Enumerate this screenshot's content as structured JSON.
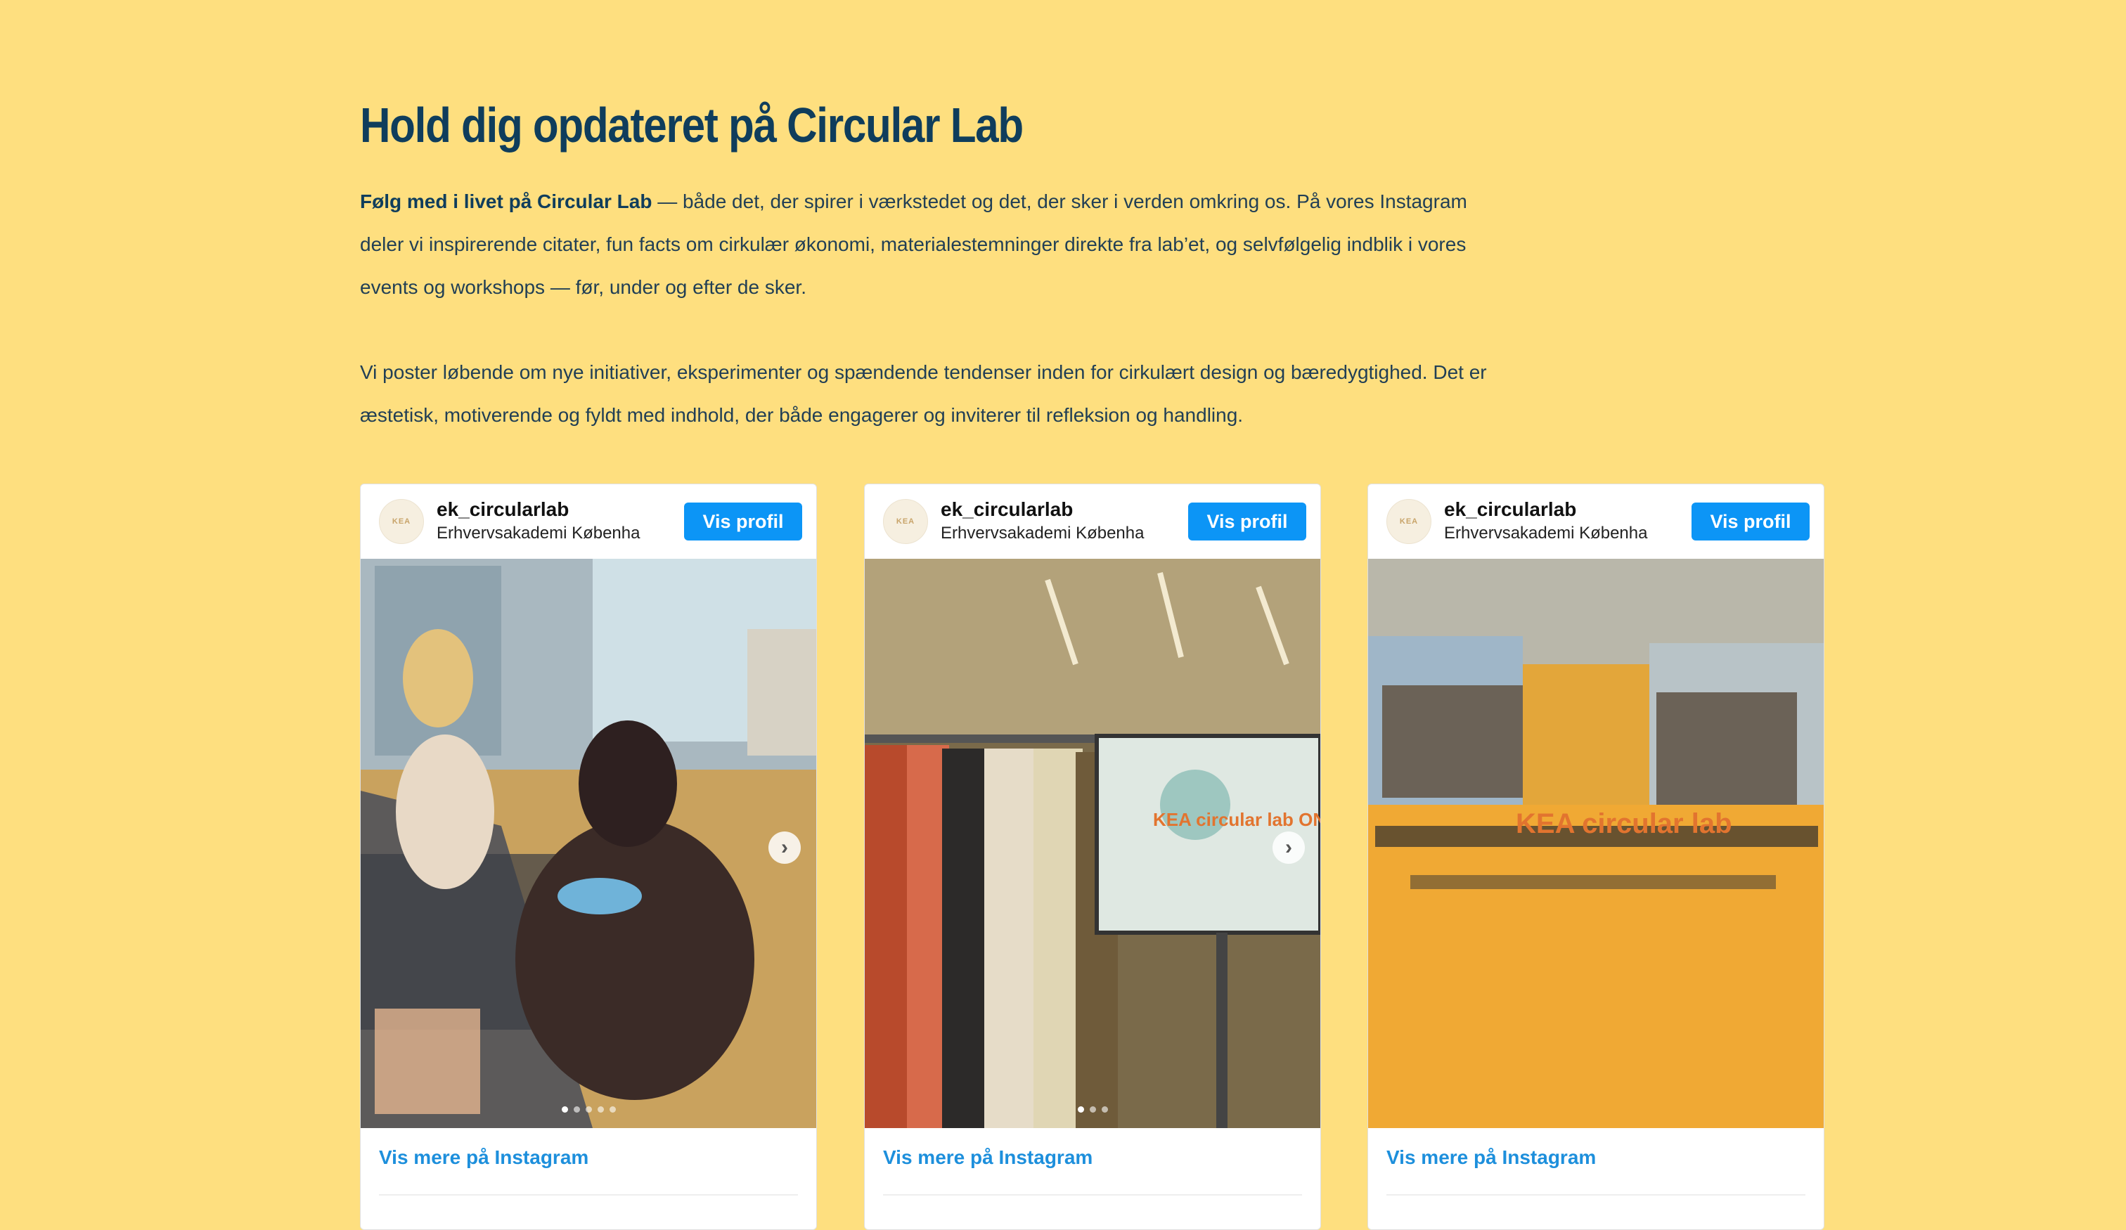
{
  "header": {
    "title": "Hold dig opdateret på Circular Lab"
  },
  "intro": {
    "lead": "Følg med i livet på Circular Lab",
    "p1_rest": " — både det, der spirer i værkstedet og det, der sker i verden omkring os. På vores Instagram deler vi inspirerende citater, fun facts om cirkulær økonomi, materialestemninger direkte fra lab’et, og selvfølgelig indblik i vores events og workshops — før, under og efter de sker.",
    "p2": "Vi poster løbende om nye initiativer, eksperimenter og spændende tendenser inden for cirkulært design og bæredygtighed. Det er æstetisk, motiverende og fyldt med indhold, der både engagerer og inviterer til refleksion og handling."
  },
  "posts": [
    {
      "username": "ek_circularlab",
      "location": "Erhvervsakademi Københa",
      "profile_button": "Vis profil",
      "more_link": "Vis mere på Instagram",
      "image_caption": ""
    },
    {
      "username": "ek_circularlab",
      "location": "Erhvervsakademi Københa",
      "profile_button": "Vis profil",
      "more_link": "Vis mere på Instagram",
      "image_caption": "KEA circular lab ONSDAGSBAR"
    },
    {
      "username": "ek_circularlab",
      "location": "Erhvervsakademi Københa",
      "profile_button": "Vis profil",
      "more_link": "Vis mere på Instagram",
      "image_caption": "KEA circular lab"
    }
  ],
  "colors": {
    "background": "#fedf7f",
    "heading": "#0f3d5c",
    "button": "#0c95f6",
    "link": "#1d8fdc"
  }
}
